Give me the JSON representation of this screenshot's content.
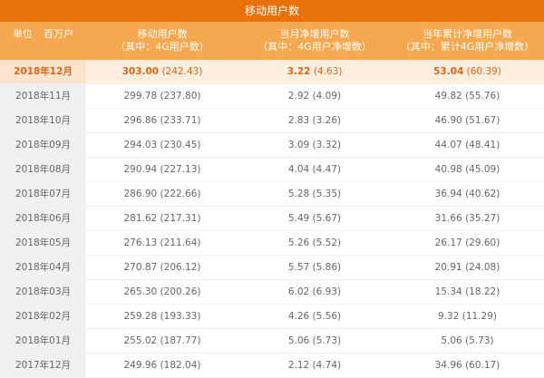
{
  "title": "移动用户数",
  "header": {
    "unit_label": "单位",
    "unit_value": "百万户",
    "col1": {
      "main": "移动用户数",
      "sub": "（其中：4G用户数）"
    },
    "col2": {
      "main": "当月净增用户数",
      "sub": "（其中：4G用户净增数）"
    },
    "col3": {
      "main": "当年累计净增用户数",
      "sub": "（其中：累计4G用户净增数）"
    }
  },
  "rows": [
    {
      "month": "2018年12月",
      "c1_main": "303.00",
      "c1_sub": " (242.43)",
      "c2_main": "3.22",
      "c2_sub": " (4.63)",
      "c3_main": "53.04",
      "c3_sub": " (60.39)"
    },
    {
      "month": "2018年11月",
      "c1": "299.78 (237.80)",
      "c2": "2.92 (4.09)",
      "c3": "49.82 (55.76)"
    },
    {
      "month": "2018年10月",
      "c1": "296.86 (233.71)",
      "c2": "2.83 (3.26)",
      "c3": "46.90 (51.67)"
    },
    {
      "month": "2018年09月",
      "c1": "294.03 (230.45)",
      "c2": "3.09 (3.32)",
      "c3": "44.07 (48.41)"
    },
    {
      "month": "2018年08月",
      "c1": "290.94 (227.13)",
      "c2": "4.04 (4.47)",
      "c3": "40.98 (45.09)"
    },
    {
      "month": "2018年07月",
      "c1": "286.90 (222.66)",
      "c2": "5.28 (5.35)",
      "c3": "36.94 (40.62)"
    },
    {
      "month": "2018年06月",
      "c1": "281.62 (217.31)",
      "c2": "5.49 (5.67)",
      "c3": "31.66 (35.27)"
    },
    {
      "month": "2018年05月",
      "c1": "276.13 (211.64)",
      "c2": "5.26 (5.52)",
      "c3": "26.17 (29.60)"
    },
    {
      "month": "2018年04月",
      "c1": "270.87 (206.12)",
      "c2": "5.57 (5.86)",
      "c3": "20.91 (24.08)"
    },
    {
      "month": "2018年03月",
      "c1": "265.30 (200.26)",
      "c2": "6.02 (6.93)",
      "c3": "15.34 (18.22)"
    },
    {
      "month": "2018年02月",
      "c1": "259.28 (193.33)",
      "c2": "4.26 (5.56)",
      "c3": "9.32 (11.29)"
    },
    {
      "month": "2018年01月",
      "c1": "255.02 (187.77)",
      "c2": "5.06 (5.73)",
      "c3": "5.06 (5.73)"
    },
    {
      "month": "2017年12月",
      "c1": "249.96 (182.04)",
      "c2": "2.12 (4.74)",
      "c3": "34.96 (60.17)"
    }
  ],
  "colors": {
    "title_bg": "#e8710a",
    "header_bg": "#f6a84f",
    "highlight_text": "#d9661a",
    "highlight_bg": "#fdeede"
  }
}
